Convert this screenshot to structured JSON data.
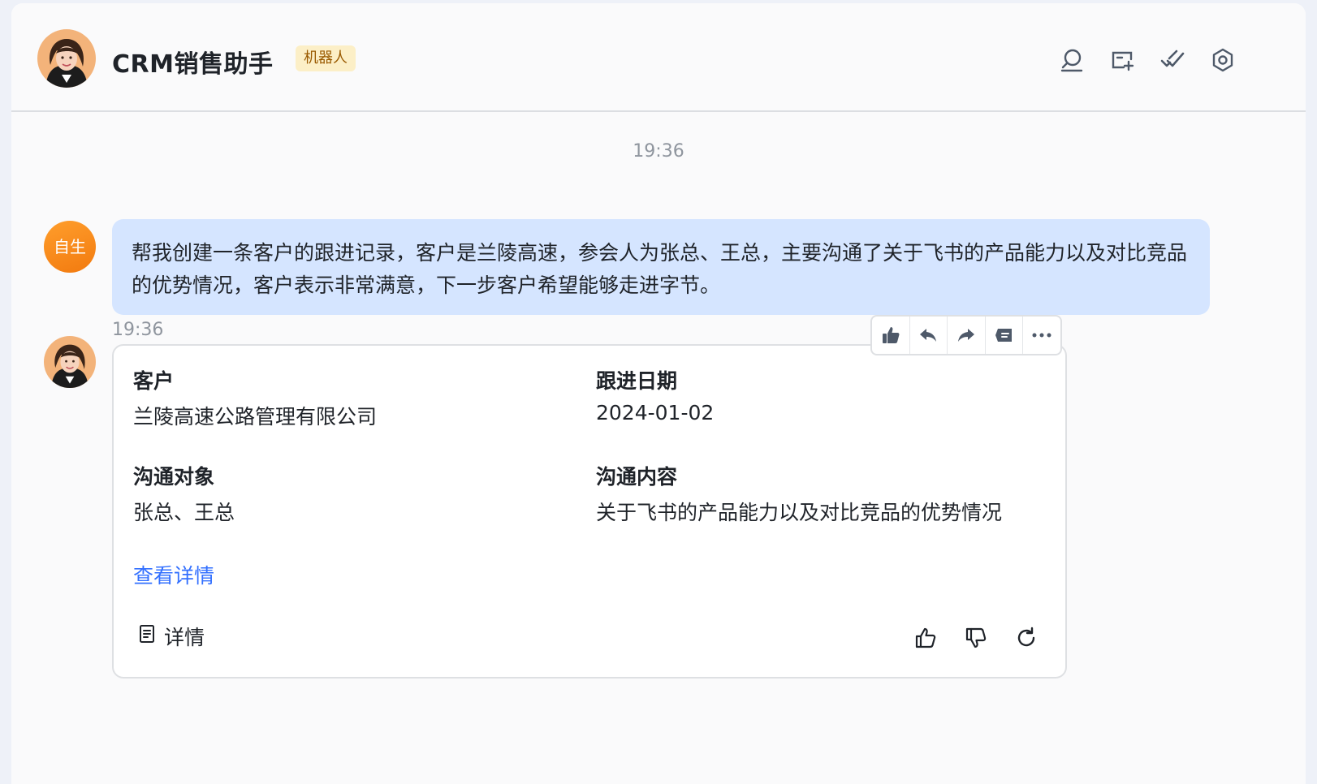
{
  "header": {
    "title": "CRM销售助手",
    "badge": "机器人",
    "icons": [
      "search-icon",
      "new-window-icon",
      "check-icon",
      "settings-icon"
    ]
  },
  "chat": {
    "time_center": "19:36",
    "user": {
      "avatar_text": "自生",
      "message": "帮我创建一条客户的跟进记录，客户是兰陵高速，参会人为张总、王总，主要沟通了关于飞书的产品能力以及对比竞品的优势情况，客户表示非常满意，下一步客户希望能够走进字节。"
    },
    "bot_time": "19:36",
    "card": {
      "customer_label": "客户",
      "customer_value": "兰陵高速公路管理有限公司",
      "date_label": "跟进日期",
      "date_value": "2024-01-02",
      "contact_label": "沟通对象",
      "contact_value": "张总、王总",
      "content_label": "沟通内容",
      "content_value": "关于飞书的产品能力以及对比竞品的优势情况",
      "link": "查看详情",
      "detail_button": "详情"
    },
    "toolbar_icons": [
      "thumbs-up-icon",
      "reply-icon",
      "forward-icon",
      "unread-icon",
      "more-icon"
    ]
  },
  "colors": {
    "accent_link": "#3370ff",
    "user_bubble": "#d5e5ff",
    "badge_bg": "#fcefc7",
    "user_avatar": "#f7861a"
  }
}
